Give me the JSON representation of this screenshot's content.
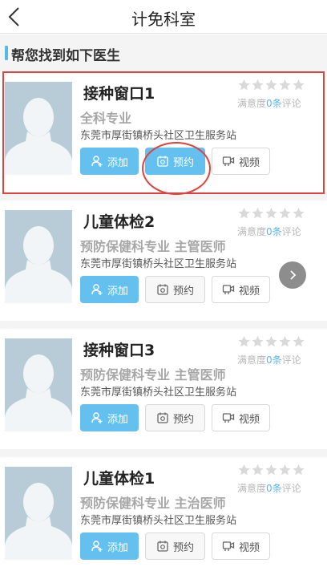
{
  "header": {
    "title": "计免科室",
    "back_icon": "chevron-left-icon"
  },
  "section": {
    "title": "帮您找到如下医生"
  },
  "doctors": [
    {
      "name": "接种窗口1",
      "specialty": "全科专业",
      "org": "东莞市厚街镇桥头社区卫生服务站",
      "stars": 0,
      "rating_prefix": "满意度",
      "rating_count": "0条",
      "rating_suffix": "评论",
      "add_label": "添加",
      "book_label": "预约",
      "video_label": "视频",
      "book_active": true
    },
    {
      "name": "儿童体检2",
      "specialty": "预防保健科专业 主管医师",
      "org": "东莞市厚街镇桥头社区卫生服务站",
      "stars": 0,
      "rating_prefix": "满意度",
      "rating_count": "0条",
      "rating_suffix": "评论",
      "add_label": "添加",
      "book_label": "预约",
      "video_label": "视频",
      "book_active": false
    },
    {
      "name": "接种窗口3",
      "specialty": "预防保健科专业 主管医师",
      "org": "东莞市厚街镇桥头社区卫生服务站",
      "stars": 0,
      "rating_prefix": "满意度",
      "rating_count": "0条",
      "rating_suffix": "评论",
      "add_label": "添加",
      "book_label": "预约",
      "video_label": "视频",
      "book_active": false
    },
    {
      "name": "儿童体检1",
      "specialty": "预防保健科专业 主治医师",
      "org": "东莞市厚街镇桥头社区卫生服务站",
      "stars": 0,
      "rating_prefix": "满意度",
      "rating_count": "0条",
      "rating_suffix": "评论",
      "add_label": "添加",
      "book_label": "预约",
      "video_label": "视频",
      "book_active": false
    }
  ],
  "colors": {
    "accent": "#64c0ef",
    "highlight": "#e0423f",
    "star": "#d9d9d9"
  },
  "icons": {
    "add": "user-add-icon",
    "book": "calendar-icon",
    "video": "video-call-icon",
    "star": "star-icon",
    "next": "chevron-right-icon",
    "avatar": "avatar-silhouette-icon"
  }
}
